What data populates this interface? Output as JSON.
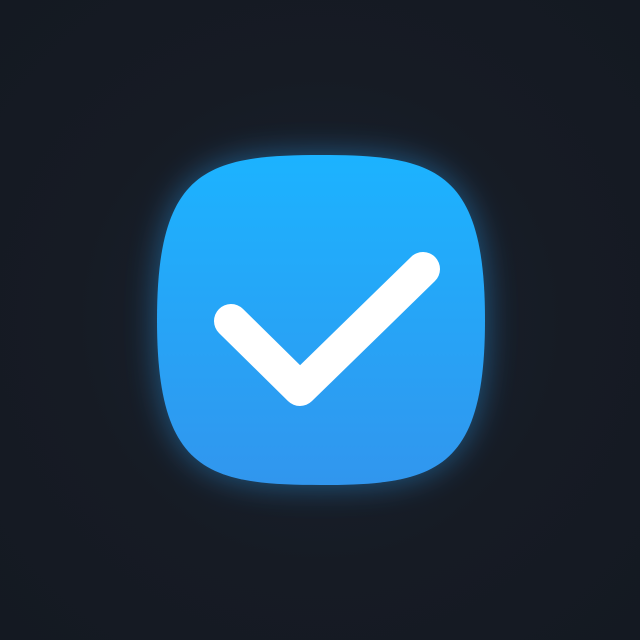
{
  "icon": {
    "name": "checkmark-icon",
    "colors": {
      "background": "#161b24",
      "glow": "#2aa8ff",
      "tile_top": "#1cb3ff",
      "tile_bottom": "#3196ee",
      "check": "#ffffff"
    }
  }
}
